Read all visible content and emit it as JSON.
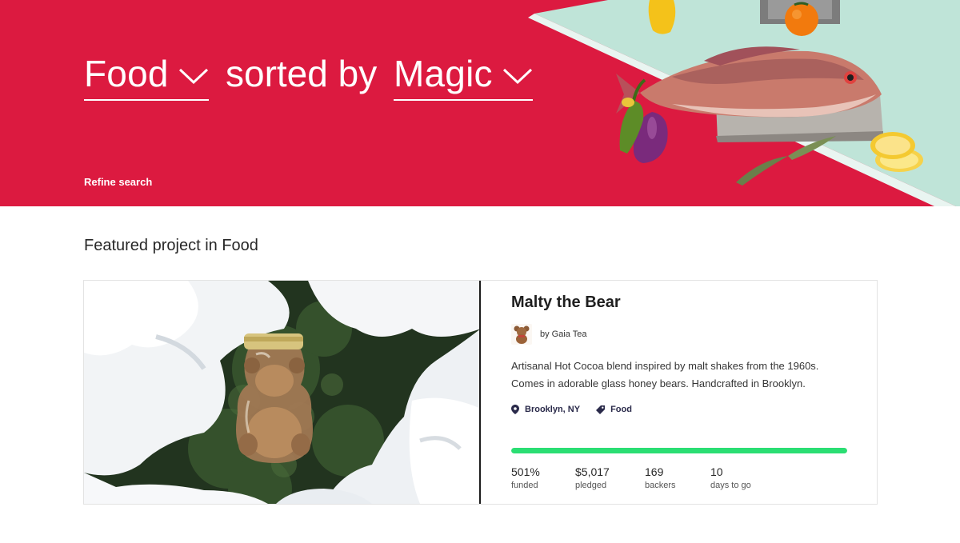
{
  "hero": {
    "category": "Food",
    "sorted_by_label": "sorted by",
    "sort": "Magic",
    "refine_label": "Refine search",
    "background_color": "#dc1a40"
  },
  "featured": {
    "section_title": "Featured project in Food",
    "project": {
      "title": "Malty the Bear",
      "creator": "by Gaia Tea",
      "blurb": "Artisanal Hot Cocoa blend inspired by malt shakes from the 1960s. Comes in adorable glass honey bears. Handcrafted in Brooklyn.",
      "location": "Brooklyn, NY",
      "category": "Food",
      "location_icon": "map-pin-icon",
      "category_icon": "tag-icon",
      "funded_fraction": 1.0,
      "progress_color": "#2bde73",
      "stats": [
        {
          "value": "501%",
          "label": "funded"
        },
        {
          "value": "$5,017",
          "label": "pledged"
        },
        {
          "value": "169",
          "label": "backers"
        },
        {
          "value": "10",
          "label": "days to go"
        }
      ]
    }
  }
}
